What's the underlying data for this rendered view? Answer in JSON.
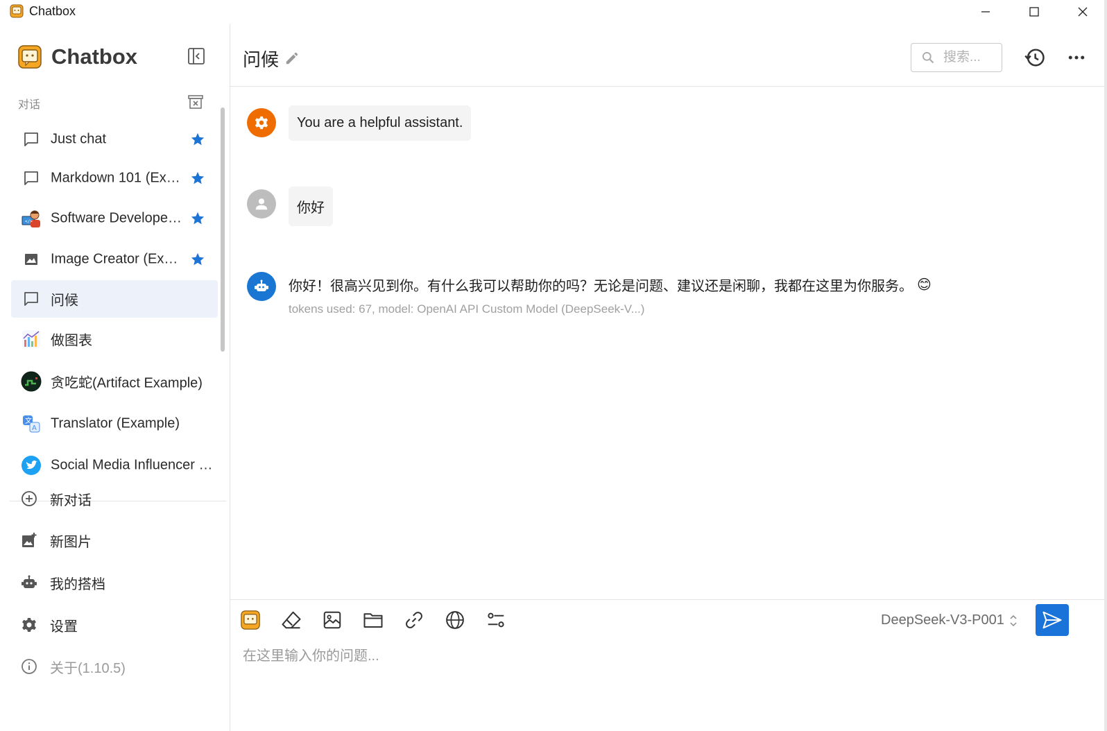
{
  "window": {
    "title": "Chatbox"
  },
  "sidebar": {
    "brand": "Chatbox",
    "section_label": "对话",
    "conversations": [
      {
        "label": "Just chat",
        "icon": "chat-bubble-icon",
        "starred": true
      },
      {
        "label": "Markdown 101 (Example)",
        "icon": "chat-bubble-icon",
        "starred": true
      },
      {
        "label": "Software Developer (Example)",
        "icon": "developer-avatar-icon",
        "starred": true
      },
      {
        "label": "Image Creator (Example)",
        "icon": "image-icon",
        "starred": true
      },
      {
        "label": "问候",
        "icon": "chat-bubble-icon",
        "starred": false,
        "active": true
      },
      {
        "label": "做图表",
        "icon": "chart-avatar-icon",
        "starred": false
      },
      {
        "label": "贪吃蛇(Artifact Example)",
        "icon": "snake-game-avatar-icon",
        "starred": false
      },
      {
        "label": "Translator (Example)",
        "icon": "translate-avatar-icon",
        "starred": false
      },
      {
        "label": "Social Media Influencer (Example)",
        "icon": "twitter-bird-icon",
        "starred": false
      }
    ],
    "menu": [
      {
        "label": "新对话",
        "icon": "plus-circle-icon"
      },
      {
        "label": "新图片",
        "icon": "add-image-icon"
      },
      {
        "label": "我的搭档",
        "icon": "robot-icon"
      },
      {
        "label": "设置",
        "icon": "gear-icon"
      },
      {
        "label": "关于(1.10.5)",
        "icon": "info-icon"
      }
    ]
  },
  "header": {
    "title": "问候",
    "search_placeholder": "搜索..."
  },
  "messages": [
    {
      "role": "system",
      "text": "You are a helpful assistant."
    },
    {
      "role": "user",
      "text": "你好"
    },
    {
      "role": "assistant",
      "text": "你好！很高兴见到你。有什么我可以帮助你的吗？无论是问题、建议还是闲聊，我都在这里为你服务。",
      "emoji": "😊",
      "meta": "tokens used: 67, model: OpenAI API Custom Model (DeepSeek-V...)"
    }
  ],
  "composer": {
    "model": "DeepSeek-V3-P001",
    "placeholder": "在这里输入你的问题..."
  },
  "colors": {
    "accent": "#1a73d9",
    "star": "#1e74d6",
    "system_avatar": "#ef6c00",
    "user_avatar": "#bdbdbd",
    "assistant_avatar": "#1976d2",
    "active_item_bg": "#edf2fa"
  }
}
